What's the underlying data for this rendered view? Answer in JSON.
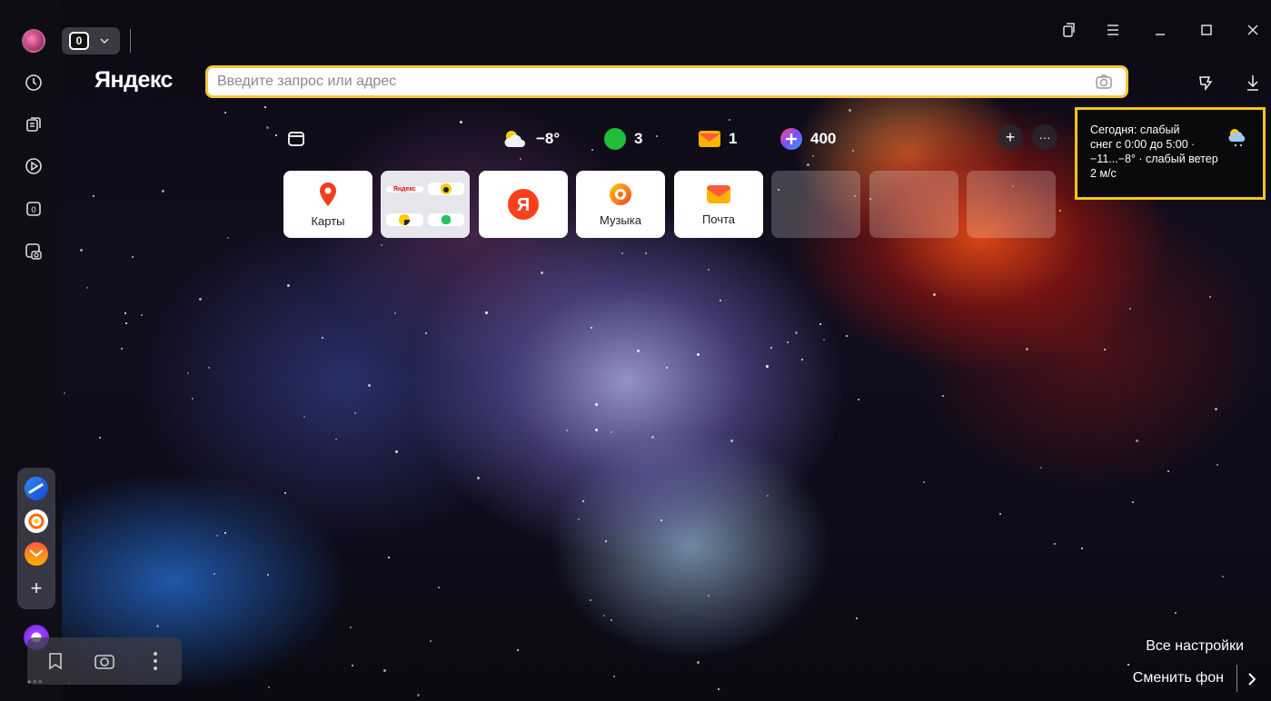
{
  "browser": {
    "tab_count": "0",
    "logo": "Яндекс",
    "address_placeholder": "Введите запрос или адрес"
  },
  "sidebar": {
    "items": [
      {
        "icon": "history-icon"
      },
      {
        "icon": "collections-icon"
      },
      {
        "icon": "video-play-icon"
      },
      {
        "icon": "tab-counter-icon",
        "label": "0"
      },
      {
        "icon": "screenshot-icon"
      }
    ],
    "services": [
      "messenger-icon",
      "music-icon",
      "mail-icon",
      "add-icon"
    ]
  },
  "widgets": {
    "weather": "−8°",
    "traffic": "3",
    "mail": "1",
    "plus": "400"
  },
  "tiles": [
    {
      "label": "Карты",
      "icon": "maps-icon"
    },
    {
      "label": "",
      "icon": "yandex-group-icon",
      "mini_label": "Яндекс"
    },
    {
      "label": "",
      "icon": "yandex-icon",
      "letter": "Я"
    },
    {
      "label": "Музыка",
      "icon": "music-icon"
    },
    {
      "label": "Почта",
      "icon": "mail-icon"
    },
    {
      "label": "",
      "icon": ""
    },
    {
      "label": "",
      "icon": ""
    },
    {
      "label": "",
      "icon": ""
    }
  ],
  "weather_tooltip": {
    "lines": [
      "Сегодня: слабый",
      "снег с 0:00 до 5:00 ·",
      "−11...−8° · слабый ветер",
      "2 м/с"
    ]
  },
  "bottom": {
    "settings_label": "Все настройки",
    "change_bg_label": "Сменить фон"
  },
  "colors": {
    "accent_yellow": "#f5c518",
    "maps_red": "#f03e1e",
    "yandex_red": "#fc3f1d",
    "alice_purple": "#8a2be2"
  }
}
